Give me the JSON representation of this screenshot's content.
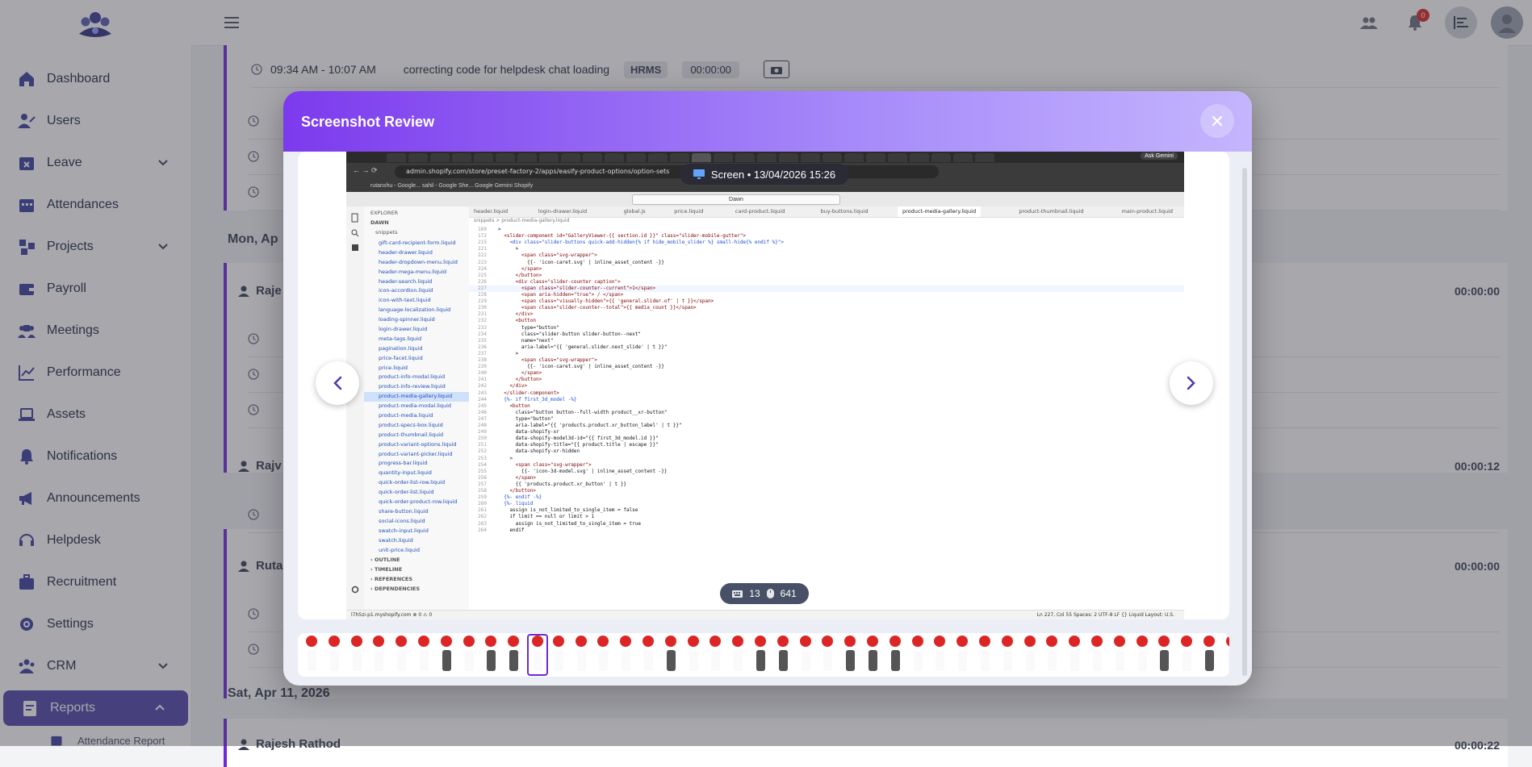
{
  "sidebar": {
    "items": [
      {
        "label": "Dashboard",
        "icon": "home-icon"
      },
      {
        "label": "Users",
        "icon": "users-icon"
      },
      {
        "label": "Leave",
        "icon": "calendar-x-icon"
      },
      {
        "label": "Attendances",
        "icon": "calendar-icon"
      },
      {
        "label": "Projects",
        "icon": "projects-icon"
      },
      {
        "label": "Payroll",
        "icon": "wallet-icon"
      },
      {
        "label": "Meetings",
        "icon": "meetings-icon"
      },
      {
        "label": "Performance",
        "icon": "chart-line-icon"
      },
      {
        "label": "Assets",
        "icon": "laptop-icon"
      },
      {
        "label": "Notifications",
        "icon": "bell-icon"
      },
      {
        "label": "Announcements",
        "icon": "megaphone-icon"
      },
      {
        "label": "Helpdesk",
        "icon": "headset-icon"
      },
      {
        "label": "Recruitment",
        "icon": "briefcase-icon"
      },
      {
        "label": "Settings",
        "icon": "gear-icon"
      },
      {
        "label": "CRM",
        "icon": "group-icon"
      },
      {
        "label": "Reports",
        "icon": "report-icon"
      }
    ],
    "subitem": "Attendance Report"
  },
  "topbar": {
    "notification_count": "0"
  },
  "background": {
    "row1": {
      "time": "09:34 AM - 10:07 AM",
      "desc": "correcting code for helpdesk chat loading",
      "project": "HRMS",
      "duration": "00:00:00"
    },
    "date1": "Mon, Ap",
    "persons": [
      {
        "name": "Raje",
        "duration": "00:00:00"
      },
      {
        "name": "Rajv",
        "duration": "00:00:12"
      },
      {
        "name": "Ruta",
        "duration": "00:00:00"
      }
    ],
    "date2": "Sat, Apr 11, 2026",
    "person4": "Rajesh Rathod",
    "person4_duration": "00:00:22"
  },
  "modal": {
    "title": "Screenshot Review",
    "screen_label": "Screen • 13/04/2026 15:26",
    "key_count": "13",
    "mouse_count": "641"
  },
  "shot": {
    "url": "admin.shopify.com/store/preset-factory-2/apps/easify-product-options/option-sets",
    "ask": "Ask Gemini",
    "bookmarks": "rutanshu - Google...   sahil - Google She...   Google Gemini   Shopify",
    "search": "Dawn",
    "explorer_title": "EXPLORER",
    "root": "DAWN",
    "folder": "snippets",
    "files": [
      "gift-card-recipient-form.liquid",
      "header-drawer.liquid",
      "header-dropdown-menu.liquid",
      "header-mega-menu.liquid",
      "header-search.liquid",
      "icon-accordion.liquid",
      "icon-with-text.liquid",
      "language-localization.liquid",
      "loading-spinner.liquid",
      "login-drawer.liquid",
      "meta-tags.liquid",
      "pagination.liquid",
      "price-facet.liquid",
      "price.liquid",
      "product-info-modal.liquid",
      "product-info-review.liquid",
      "product-media-gallery.liquid",
      "product-media-modal.liquid",
      "product-media.liquid",
      "product-specs-box.liquid",
      "product-thumbnail.liquid",
      "product-variant-options.liquid",
      "product-variant-picker.liquid",
      "progress-bar.liquid",
      "quantity-input.liquid",
      "quick-order-list-row.liquid",
      "quick-order-list.liquid",
      "quick-order-product-row.liquid",
      "share-button.liquid",
      "social-icons.liquid",
      "swatch-input.liquid",
      "swatch.liquid",
      "unit-price.liquid"
    ],
    "sections": [
      "OUTLINE",
      "TIMELINE",
      "REFERENCES",
      "DEPENDENCIES"
    ],
    "tabs": [
      "header.liquid",
      "login-drawer.liquid",
      "global.js",
      "price.liquid",
      "card-product.liquid",
      "buy-buttons.liquid",
      "product-media-gallery.liquid",
      "product-thumbnail.liquid",
      "main-product.liquid"
    ],
    "crumb": "snippets  >  product-media-gallery.liquid",
    "code": [
      {
        "n": "169",
        "t": ">"
      },
      {
        "n": "172",
        "t": "  <slider-component id=\"GalleryViewer-{{ section.id }}\" class=\"slider-mobile-gutter\">"
      },
      {
        "n": "215",
        "t": "    <div class=\"slider-buttons quick-add-hidden{% if hide_mobile_slider %} small-hide{% endif %}\">"
      },
      {
        "n": "221",
        "t": "      >"
      },
      {
        "n": "222",
        "t": "        <span class=\"svg-wrapper\">"
      },
      {
        "n": "223",
        "t": "          {{- 'icon-caret.svg' | inline_asset_content -}}"
      },
      {
        "n": "224",
        "t": "        </span>"
      },
      {
        "n": "225",
        "t": "      </button>"
      },
      {
        "n": "226",
        "t": "      <div class=\"slider-counter caption\">"
      },
      {
        "n": "227",
        "t": "        <span class=\"slider-counter--current\">1</span>"
      },
      {
        "n": "228",
        "t": "        <span aria-hidden=\"true\"> / </span>"
      },
      {
        "n": "229",
        "t": "        <span class=\"visually-hidden\">{{ 'general.slider.of' | t }}</span>"
      },
      {
        "n": "230",
        "t": "        <span class=\"slider-counter--total\">{{ media_count }}</span>"
      },
      {
        "n": "231",
        "t": "      </div>"
      },
      {
        "n": "232",
        "t": "      <button"
      },
      {
        "n": "233",
        "t": "        type=\"button\""
      },
      {
        "n": "234",
        "t": "        class=\"slider-button slider-button--next\""
      },
      {
        "n": "235",
        "t": "        name=\"next\""
      },
      {
        "n": "236",
        "t": "        aria-label=\"{{ 'general.slider.next_slide' | t }}\""
      },
      {
        "n": "237",
        "t": "      >"
      },
      {
        "n": "238",
        "t": "        <span class=\"svg-wrapper\">"
      },
      {
        "n": "239",
        "t": "          {{- 'icon-caret.svg' | inline_asset_content -}}"
      },
      {
        "n": "240",
        "t": "        </span>"
      },
      {
        "n": "241",
        "t": "      </button>"
      },
      {
        "n": "242",
        "t": "    </div>"
      },
      {
        "n": "243",
        "t": "  </slider-component>"
      },
      {
        "n": "244",
        "t": "  {%- if first_3d_model -%}"
      },
      {
        "n": "245",
        "t": "    <button"
      },
      {
        "n": "246",
        "t": "      class=\"button button--full-width product__xr-button\""
      },
      {
        "n": "247",
        "t": "      type=\"button\""
      },
      {
        "n": "248",
        "t": "      aria-label=\"{{ 'products.product.xr_button_label' | t }}\""
      },
      {
        "n": "249",
        "t": "      data-shopify-xr"
      },
      {
        "n": "250",
        "t": "      data-shopify-model3d-id=\"{{ first_3d_model.id }}\""
      },
      {
        "n": "251",
        "t": "      data-shopify-title=\"{{ product.title | escape }}\""
      },
      {
        "n": "252",
        "t": "      data-shopify-xr-hidden"
      },
      {
        "n": "253",
        "t": "    >"
      },
      {
        "n": "254",
        "t": "      <span class=\"svg-wrapper\">"
      },
      {
        "n": "255",
        "t": "        {{- 'icon-3d-model.svg' | inline_asset_content -}}"
      },
      {
        "n": "256",
        "t": "      </span>"
      },
      {
        "n": "257",
        "t": "      {{ 'products.product.xr_button' | t }}"
      },
      {
        "n": "258",
        "t": "    </button>"
      },
      {
        "n": "259",
        "t": "  {%- endif -%}"
      },
      {
        "n": "260",
        "t": "  {%- liquid"
      },
      {
        "n": "261",
        "t": "    assign is_not_limited_to_single_item = false"
      },
      {
        "n": "262",
        "t": "    if limit == null or limit > 1"
      },
      {
        "n": "263",
        "t": "      assign is_not_limited_to_single_item = true"
      },
      {
        "n": "264",
        "t": "    endif"
      }
    ],
    "status_left": "l7h5zi-p1.myshopify.com   ⊗ 0 ⚠ 0",
    "status_right": "Ln 227, Col 55   Spaces: 2   UTF-8   LF   {} Liquid   Layout: U.S."
  }
}
